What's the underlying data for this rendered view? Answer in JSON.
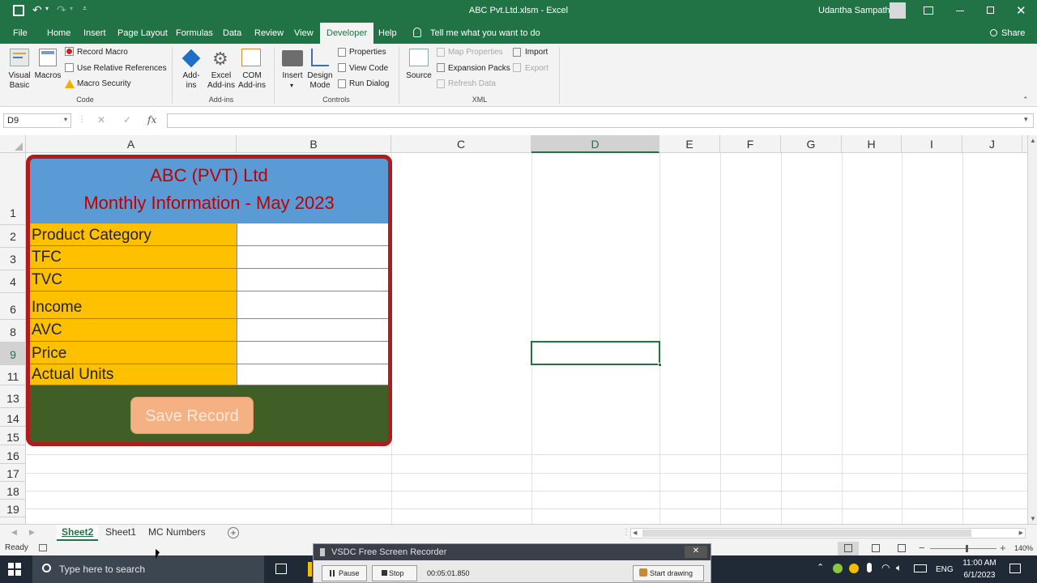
{
  "window": {
    "title": "ABC Pvt.Ltd.xlsm  -  Excel",
    "user": "Udantha Sampath",
    "share_label": "Share"
  },
  "ribbon_tabs": [
    "File",
    "Home",
    "Insert",
    "Page Layout",
    "Formulas",
    "Data",
    "Review",
    "View",
    "Developer",
    "Help"
  ],
  "active_tab": "Developer",
  "tell_me": "Tell me what you want to do",
  "ribbon": {
    "code": {
      "visual_basic": "Visual Basic",
      "macros": "Macros",
      "record_macro": "Record Macro",
      "use_relative": "Use Relative References",
      "macro_security": "Macro Security",
      "group_label": "Code"
    },
    "addins": {
      "addins": "Add-ins",
      "excel_addins": "Excel Add-ins",
      "com_addins": "COM Add-ins",
      "group_label": "Add-ins"
    },
    "controls": {
      "insert": "Insert",
      "design_mode": "Design Mode",
      "properties": "Properties",
      "view_code": "View Code",
      "run_dialog": "Run Dialog",
      "group_label": "Controls"
    },
    "xml": {
      "source": "Source",
      "map_properties": "Map Properties",
      "expansion_packs": "Expansion Packs",
      "refresh_data": "Refresh Data",
      "import": "Import",
      "export": "Export",
      "group_label": "XML"
    }
  },
  "formula_bar": {
    "name_box": "D9",
    "fx": "fx",
    "content": ""
  },
  "columns": [
    "A",
    "B",
    "C",
    "D",
    "E",
    "F",
    "G",
    "H",
    "I",
    "J"
  ],
  "selected_column": "D",
  "rows": [
    "1",
    "2",
    "3",
    "4",
    "6",
    "8",
    "9",
    "11",
    "13",
    "14",
    "15",
    "16",
    "17",
    "18",
    "19"
  ],
  "selected_row": "9",
  "form": {
    "title_line1": "ABC (PVT) Ltd",
    "title_line2": "Monthly Information - May 2023",
    "fields": [
      {
        "label": "Product Category",
        "value": ""
      },
      {
        "label": "TFC",
        "value": ""
      },
      {
        "label": "TVC",
        "value": ""
      },
      {
        "label": "Income",
        "value": ""
      },
      {
        "label": "AVC",
        "value": ""
      },
      {
        "label": "Price",
        "value": ""
      },
      {
        "label": "Actual Units",
        "value": ""
      }
    ],
    "save_button": "Save Record"
  },
  "sheet_tabs": [
    "Sheet2",
    "Sheet1",
    "MC Numbers"
  ],
  "active_sheet": "Sheet2",
  "status": {
    "ready": "Ready",
    "zoom": "140%"
  },
  "recorder": {
    "title": "VSDC Free Screen Recorder",
    "pause": "Pause",
    "stop": "Stop",
    "time": "00:05:01.850",
    "start_drawing": "Start drawing"
  },
  "taskbar": {
    "search_placeholder": "Type here to search",
    "language": "ENG",
    "time": "11:00 AM",
    "date": "6/1/2023"
  },
  "colors": {
    "excel_green": "#217346",
    "form_header": "#5b9bd5",
    "form_title": "#c00000",
    "label_fill": "#ffc000",
    "form_border": "#b01c1c",
    "form_footer": "#3f5f27",
    "button_fill": "#f4b183"
  }
}
